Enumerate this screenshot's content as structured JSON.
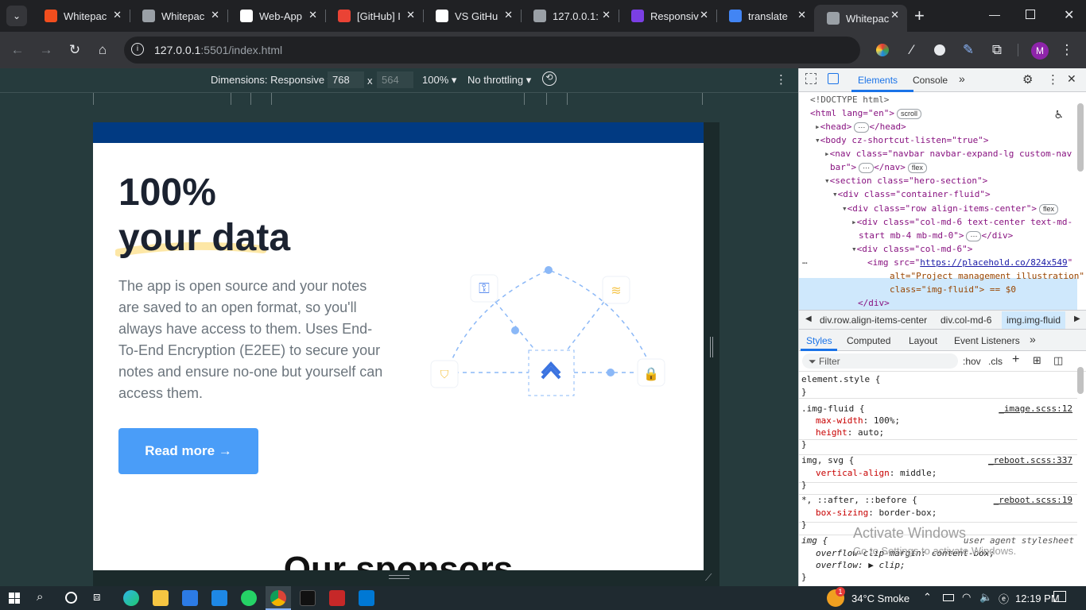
{
  "tabs": [
    {
      "title": "Whitepac",
      "icon": "figma-icon",
      "color": "#f24e1e"
    },
    {
      "title": "Whitepac",
      "icon": "globe-icon",
      "color": "#9aa0a6"
    },
    {
      "title": "Web-App",
      "icon": "github-icon",
      "color": "#ffffff"
    },
    {
      "title": "[GitHub] I",
      "icon": "gmail-icon",
      "color": "#ea4335"
    },
    {
      "title": "VS GitHu",
      "icon": "openai-icon",
      "color": "#ffffff"
    },
    {
      "title": "127.0.0.1:",
      "icon": "globe-icon",
      "color": "#9aa0a6"
    },
    {
      "title": "Responsiv",
      "icon": "responsive-icon",
      "color": "#7b3fe4"
    },
    {
      "title": "translate",
      "icon": "google-icon",
      "color": "#4285f4"
    },
    {
      "title": "Whitepac",
      "icon": "globe-icon",
      "color": "#9aa0a6"
    }
  ],
  "omnibox": {
    "host": "127.0.0.1",
    "rest": ":5501/index.html"
  },
  "device_toolbar": {
    "dimensions_label": "Dimensions: Responsive",
    "width": "768",
    "times": "x",
    "height": "564",
    "zoom": "100%",
    "throttle": "No throttling"
  },
  "page": {
    "hero_title_1": "100%",
    "hero_title_2": "your data",
    "hero_description": "The app is open source and your notes are saved to an open format, so you'll always have access to them. Uses End-To-End Encryption (E2EE) to secure your notes and ensure no-one but yourself can access them.",
    "read_more": "Read more →",
    "sponsors_heading": "Our sponsors"
  },
  "devtools": {
    "tabs": [
      "Elements",
      "Console"
    ],
    "dom": {
      "doctype": "<!DOCTYPE html>",
      "html_open": "<html lang=\"en\">",
      "scroll_pill": "scroll",
      "head": "<head>",
      "head_close": "</head>",
      "body": "<body cz-shortcut-listen=\"true\">",
      "nav_1": "<nav class=\"navbar navbar-expand-lg custom-nav",
      "nav_2": "bar\">",
      "nav_close": "</nav>",
      "flex_pill": "flex",
      "section": "<section class=\"hero-section\">",
      "container": "<div class=\"container-fluid\">",
      "row": "<div class=\"row align-items-center\">",
      "col1_1": "<div class=\"col-md-6 text-center text-md-",
      "col1_2": "start mb-4 mb-md-0\">",
      "div_close": "</div>",
      "col2": "<div class=\"col-md-6\">",
      "img_src_label": "<img src=\"",
      "img_src": "https://placehold.co/824x549",
      "img_alt": "alt=\"Project management illustration\"",
      "img_class": "class=\"img-fluid\"> == $0",
      "div_end": "</div>",
      "ellipsis": "…"
    },
    "breadcrumbs": [
      "div.row.align-items-center",
      "div.col-md-6",
      "img.img-fluid"
    ],
    "style_tabs": [
      "Styles",
      "Computed",
      "Layout",
      "Event Listeners"
    ],
    "filter_placeholder": "Filter",
    "hov": ":hov",
    "cls": ".cls",
    "styles": {
      "element_style": "element.style {",
      "img_fluid": ".img-fluid {",
      "img_fluid_src": "_image.scss:12",
      "max_width": "max-width: 100%;",
      "height": "height: auto;",
      "img_svg": "img, svg {",
      "img_svg_src": "_reboot.scss:337",
      "valign": "vertical-align: middle;",
      "universal": "*, ::after, ::before {",
      "universal_src": "_reboot.scss:19",
      "box_sizing": "box-sizing: border-box;",
      "img_ua": "img {",
      "ua_label": "user agent stylesheet",
      "overflow_clip": "overflow-clip-margin: content-box;",
      "overflow": "overflow: ▶ clip;",
      "close": "}"
    }
  },
  "watermark": {
    "title": "Activate Windows",
    "subtitle": "Go to Settings to activate Windows."
  },
  "taskbar": {
    "weather": "34°C  Smoke",
    "time": "12:19 PM",
    "badge": "1"
  }
}
